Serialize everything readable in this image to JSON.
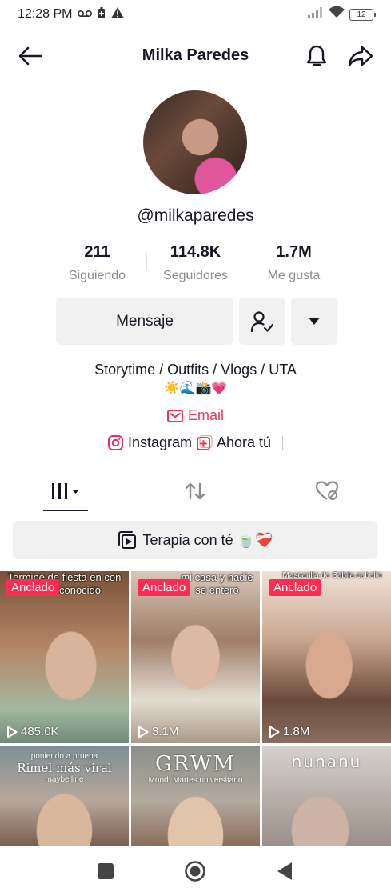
{
  "status_bar": {
    "time": "12:28 PM",
    "battery": "12"
  },
  "header": {
    "title": "Milka Paredes"
  },
  "profile": {
    "username": "@milkaparedes",
    "stats": [
      {
        "value": "211",
        "label": "Siguiendo"
      },
      {
        "value": "114.8K",
        "label": "Seguidores"
      },
      {
        "value": "1.7M",
        "label": "Me gusta"
      }
    ],
    "message_button": "Mensaje",
    "bio": "Storytime / Outfits / Vlogs / UTA",
    "bio_emojis": "☀️🌊📸💗",
    "email_label": "Email",
    "instagram_label": "Instagram",
    "ahora_label": "Ahora tú"
  },
  "playlist": {
    "label": "Terapia con té 🍵❤️‍🩹"
  },
  "videos": [
    {
      "overlay": "Terminé de fiesta en con un desconocido",
      "pinned": "Anclado",
      "plays": "485.0K"
    },
    {
      "overlay": "mi casa y nadie se entero",
      "pinned": "Anclado",
      "plays": "3.1M"
    },
    {
      "overlay": "Mascarilla de Sábila cabello",
      "pinned": "Anclado",
      "plays": "1.8M"
    },
    {
      "caption_small": "poniendo a prueba",
      "caption_title": "Rimel más viral",
      "caption_sub": "maybelline"
    },
    {
      "caption_title": "GRWM",
      "caption_sub": "Mood: Martes universitario"
    },
    {
      "caption_title": "nunanu"
    }
  ],
  "colors": {
    "accent": "#fe2c55",
    "email": "#e5395c",
    "text": "#161823",
    "muted": "#8a8b91",
    "button_bg": "#f1f1f2"
  },
  "icons": [
    "back-arrow-icon",
    "bell-icon",
    "share-icon",
    "follow-check-icon",
    "dropdown-triangle-icon",
    "mail-icon",
    "instagram-icon",
    "add-box-icon",
    "grid-icon",
    "repost-icon",
    "liked-hidden-icon",
    "playlist-icon",
    "play-icon",
    "nav-square-icon",
    "nav-home-icon",
    "nav-back-icon"
  ]
}
